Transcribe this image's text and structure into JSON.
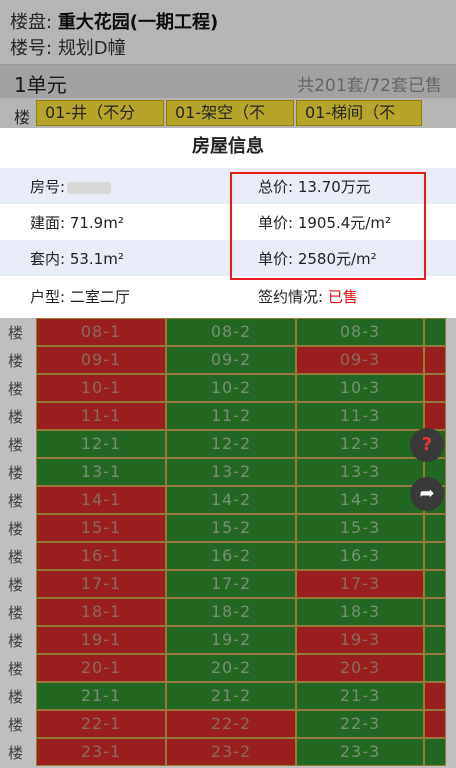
{
  "header": {
    "project_label": "楼盘:",
    "project_name": "重大花园(一期工程)",
    "building_label": "楼号:",
    "building_name": "规划D幢"
  },
  "unit": {
    "name": "1单元",
    "total": "共201套/72套已售"
  },
  "column_header": {
    "floor_label": "楼",
    "columns": [
      "01-井（不分",
      "01-架空（不",
      "01-梯间（不"
    ]
  },
  "dialog": {
    "title": "房屋信息",
    "room_label": "房号:",
    "total_price": "总价: 13.70万元",
    "area_built": "建面: 71.9m²",
    "unit_price_1": "单价: 1905.4元/m²",
    "area_inner": "套内: 53.1m²",
    "unit_price_2": "单价: 2580元/m²",
    "layout": "户型: 二室二厅",
    "contract_label": "签约情况:",
    "contract_status": "已售",
    "colors": {
      "sold_text": "#e01010",
      "highlight": "#e51c1c"
    }
  },
  "grid": {
    "floor_suffix": "楼",
    "colors": {
      "sold": "#ce2b2b",
      "available": "#2e8b2e"
    },
    "rows": [
      {
        "cells": [
          {
            "label": "08-1",
            "status": "sold"
          },
          {
            "label": "08-2",
            "status": "available"
          },
          {
            "label": "08-3",
            "status": "available"
          }
        ],
        "tail": "available"
      },
      {
        "cells": [
          {
            "label": "09-1",
            "status": "sold"
          },
          {
            "label": "09-2",
            "status": "available"
          },
          {
            "label": "09-3",
            "status": "sold"
          }
        ],
        "tail": "sold"
      },
      {
        "cells": [
          {
            "label": "10-1",
            "status": "sold"
          },
          {
            "label": "10-2",
            "status": "available"
          },
          {
            "label": "10-3",
            "status": "available"
          }
        ],
        "tail": "sold"
      },
      {
        "cells": [
          {
            "label": "11-1",
            "status": "sold"
          },
          {
            "label": "11-2",
            "status": "available"
          },
          {
            "label": "11-3",
            "status": "available"
          }
        ],
        "tail": "sold"
      },
      {
        "cells": [
          {
            "label": "12-1",
            "status": "available"
          },
          {
            "label": "12-2",
            "status": "available"
          },
          {
            "label": "12-3",
            "status": "available"
          }
        ],
        "tail": "available"
      },
      {
        "cells": [
          {
            "label": "13-1",
            "status": "available"
          },
          {
            "label": "13-2",
            "status": "available"
          },
          {
            "label": "13-3",
            "status": "available"
          }
        ],
        "tail": "available"
      },
      {
        "cells": [
          {
            "label": "14-1",
            "status": "sold"
          },
          {
            "label": "14-2",
            "status": "available"
          },
          {
            "label": "14-3",
            "status": "available"
          }
        ],
        "tail": "available"
      },
      {
        "cells": [
          {
            "label": "15-1",
            "status": "sold"
          },
          {
            "label": "15-2",
            "status": "available"
          },
          {
            "label": "15-3",
            "status": "available"
          }
        ],
        "tail": "available"
      },
      {
        "cells": [
          {
            "label": "16-1",
            "status": "sold"
          },
          {
            "label": "16-2",
            "status": "available"
          },
          {
            "label": "16-3",
            "status": "available"
          }
        ],
        "tail": "available"
      },
      {
        "cells": [
          {
            "label": "17-1",
            "status": "sold"
          },
          {
            "label": "17-2",
            "status": "available"
          },
          {
            "label": "17-3",
            "status": "sold"
          }
        ],
        "tail": "available"
      },
      {
        "cells": [
          {
            "label": "18-1",
            "status": "sold"
          },
          {
            "label": "18-2",
            "status": "available"
          },
          {
            "label": "18-3",
            "status": "available"
          }
        ],
        "tail": "available"
      },
      {
        "cells": [
          {
            "label": "19-1",
            "status": "sold"
          },
          {
            "label": "19-2",
            "status": "available"
          },
          {
            "label": "19-3",
            "status": "sold"
          }
        ],
        "tail": "available"
      },
      {
        "cells": [
          {
            "label": "20-1",
            "status": "sold"
          },
          {
            "label": "20-2",
            "status": "available"
          },
          {
            "label": "20-3",
            "status": "sold"
          }
        ],
        "tail": "available"
      },
      {
        "cells": [
          {
            "label": "21-1",
            "status": "available"
          },
          {
            "label": "21-2",
            "status": "available"
          },
          {
            "label": "21-3",
            "status": "available"
          }
        ],
        "tail": "sold"
      },
      {
        "cells": [
          {
            "label": "22-1",
            "status": "sold"
          },
          {
            "label": "22-2",
            "status": "sold"
          },
          {
            "label": "22-3",
            "status": "available"
          }
        ],
        "tail": "sold"
      },
      {
        "cells": [
          {
            "label": "23-1",
            "status": "sold"
          },
          {
            "label": "23-2",
            "status": "sold"
          },
          {
            "label": "23-3",
            "status": "available"
          }
        ],
        "tail": "available"
      }
    ]
  },
  "fab": {
    "help_icon": "question-icon",
    "help_glyph": "?",
    "share_icon": "share-arrow-icon",
    "share_glyph": "➦"
  }
}
